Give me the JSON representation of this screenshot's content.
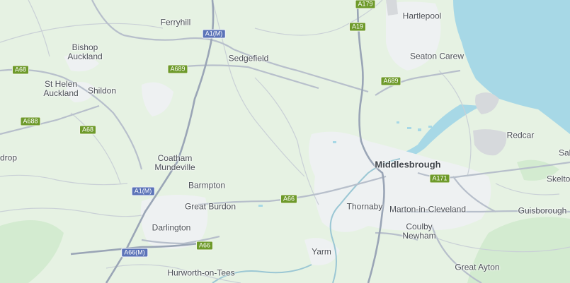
{
  "map": {
    "colors": {
      "land": "#e6f2e3",
      "sea": "#a7d8e6",
      "urban": "#eef1f2",
      "motorway": "#9aa5b6",
      "road": "#b7bfcb",
      "minor": "#c9d0d6",
      "river": "#9bc7d4",
      "industrial": "#d6d9dc",
      "shield_green": "#6e9a2a",
      "shield_blue": "#5b73b8"
    },
    "places": {
      "ferryhill": "Ferryhill",
      "hartlepool": "Hartlepool",
      "bishop_auckland_1": "Bishop",
      "bishop_auckland_2": "Auckland",
      "sedgefield": "Sedgefield",
      "seaton_carew": "Seaton Carew",
      "st_helen_1": "St Helen",
      "st_helen_2": "Auckland",
      "shildon": "Shildon",
      "redcar": "Redcar",
      "drop": "drop",
      "coatham_1": "Coatham",
      "coatham_2": "Mundeville",
      "middlesbrough": "Middlesbrough",
      "sal": "Salt",
      "skelton": "Skelto",
      "barmpton": "Barmpton",
      "great_burdon": "Great Burdon",
      "thornaby": "Thornaby",
      "marton": "Marton-in-Cleveland",
      "guisborough": "Guisborough",
      "darlington": "Darlington",
      "coulby_1": "Coulby",
      "coulby_2": "Newham",
      "yarm": "Yarm",
      "great_ayton": "Great Ayton",
      "hurworth": "Hurworth-on-Tees"
    },
    "shields": {
      "a179": "A179",
      "a1m_top": "A1(M)",
      "a19": "A19",
      "a68_left": "A68",
      "a689_mid": "A689",
      "a689_right": "A689",
      "a688": "A688",
      "a68_mid": "A68",
      "a171": "A171",
      "a1m_mid": "A1(M)",
      "a66_mid": "A66",
      "a66m": "A66(M)",
      "a66_low": "A66"
    }
  }
}
